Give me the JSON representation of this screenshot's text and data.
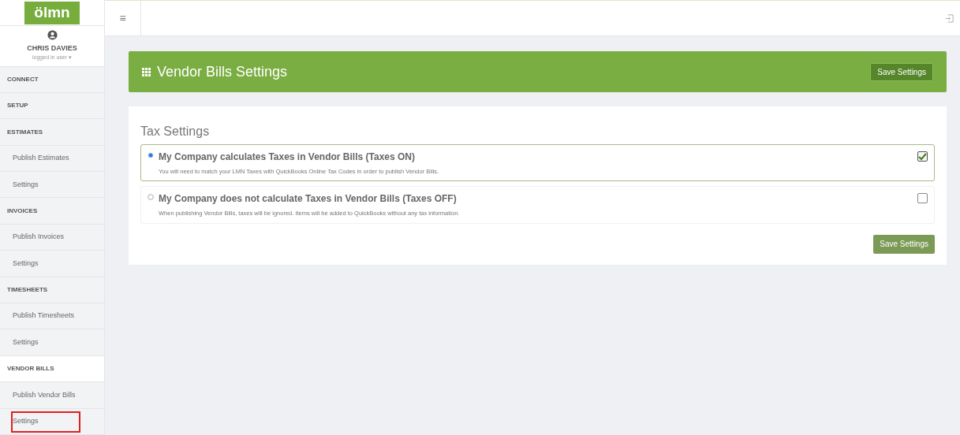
{
  "logo": {
    "text": "ölmn"
  },
  "topbar": {
    "menu_glyph": "≡"
  },
  "user": {
    "name": "CHRIS DAVIES",
    "role": "logged in user ▾"
  },
  "sidebar": {
    "items": [
      {
        "label": "CONNECT",
        "kind": "section",
        "selected": false,
        "highlighted": false
      },
      {
        "label": "SETUP",
        "kind": "section",
        "selected": false,
        "highlighted": false
      },
      {
        "label": "ESTIMATES",
        "kind": "section",
        "selected": false,
        "highlighted": false
      },
      {
        "label": "Publish Estimates",
        "kind": "link",
        "selected": false,
        "highlighted": false
      },
      {
        "label": "Settings",
        "kind": "link",
        "selected": false,
        "highlighted": false
      },
      {
        "label": "INVOICES",
        "kind": "section",
        "selected": false,
        "highlighted": false
      },
      {
        "label": "Publish Invoices",
        "kind": "link",
        "selected": false,
        "highlighted": false
      },
      {
        "label": "Settings",
        "kind": "link",
        "selected": false,
        "highlighted": false
      },
      {
        "label": "TIMESHEETS",
        "kind": "section",
        "selected": false,
        "highlighted": false
      },
      {
        "label": "Publish Timesheets",
        "kind": "link",
        "selected": false,
        "highlighted": false
      },
      {
        "label": "Settings",
        "kind": "link",
        "selected": false,
        "highlighted": false
      },
      {
        "label": "VENDOR BILLS",
        "kind": "section",
        "selected": true,
        "highlighted": false
      },
      {
        "label": "Publish Vendor Bills",
        "kind": "link",
        "selected": false,
        "highlighted": false
      },
      {
        "label": "Settings",
        "kind": "link",
        "selected": false,
        "highlighted": true
      }
    ]
  },
  "header": {
    "title": "Vendor Bills Settings",
    "button": "Save Settings"
  },
  "tax_settings": {
    "title": "Tax Settings",
    "options": [
      {
        "label": "My Company calculates Taxes in Vendor Bills (Taxes ON)",
        "description": "You will need to match your LMN Taxes with QuickBooks Online Tax Codes in order to publish Vendor Bills.",
        "selected": true,
        "checked": true
      },
      {
        "label": "My Company does not calculate Taxes in Vendor Bills (Taxes OFF)",
        "description": "When publishing Vendor Bills, taxes will be ignored. Items will be added to QuickBooks without any tax information.",
        "selected": false,
        "checked": false
      }
    ],
    "button": "Save Settings"
  }
}
